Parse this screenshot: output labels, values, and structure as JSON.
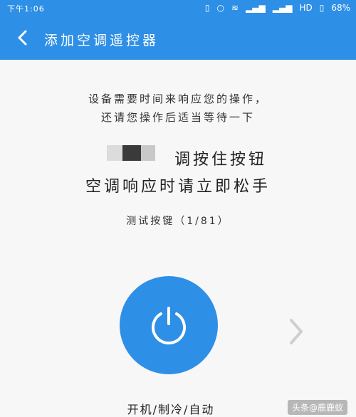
{
  "status_bar": {
    "time": "下午1:06",
    "network": "HD",
    "battery": "68%"
  },
  "app_bar": {
    "title": "添加空调遥控器"
  },
  "main": {
    "instruction_line1": "设备需要时间来响应您的操作，",
    "instruction_line2": "还请您操作后适当等待一下",
    "prompt_line1": "调按住按钮",
    "prompt_line2": "空调响应时请立即松手",
    "test_progress": "测试按键（1/81）",
    "mode_label": "开机/制冷/自动"
  },
  "watermark": "头条@鹿鹿蚁",
  "colors": {
    "accent": "#2e8fe6",
    "background": "#f7f7f7"
  },
  "icons": {
    "back": "chevron-left-icon",
    "power": "power-icon",
    "next": "chevron-right-icon"
  }
}
